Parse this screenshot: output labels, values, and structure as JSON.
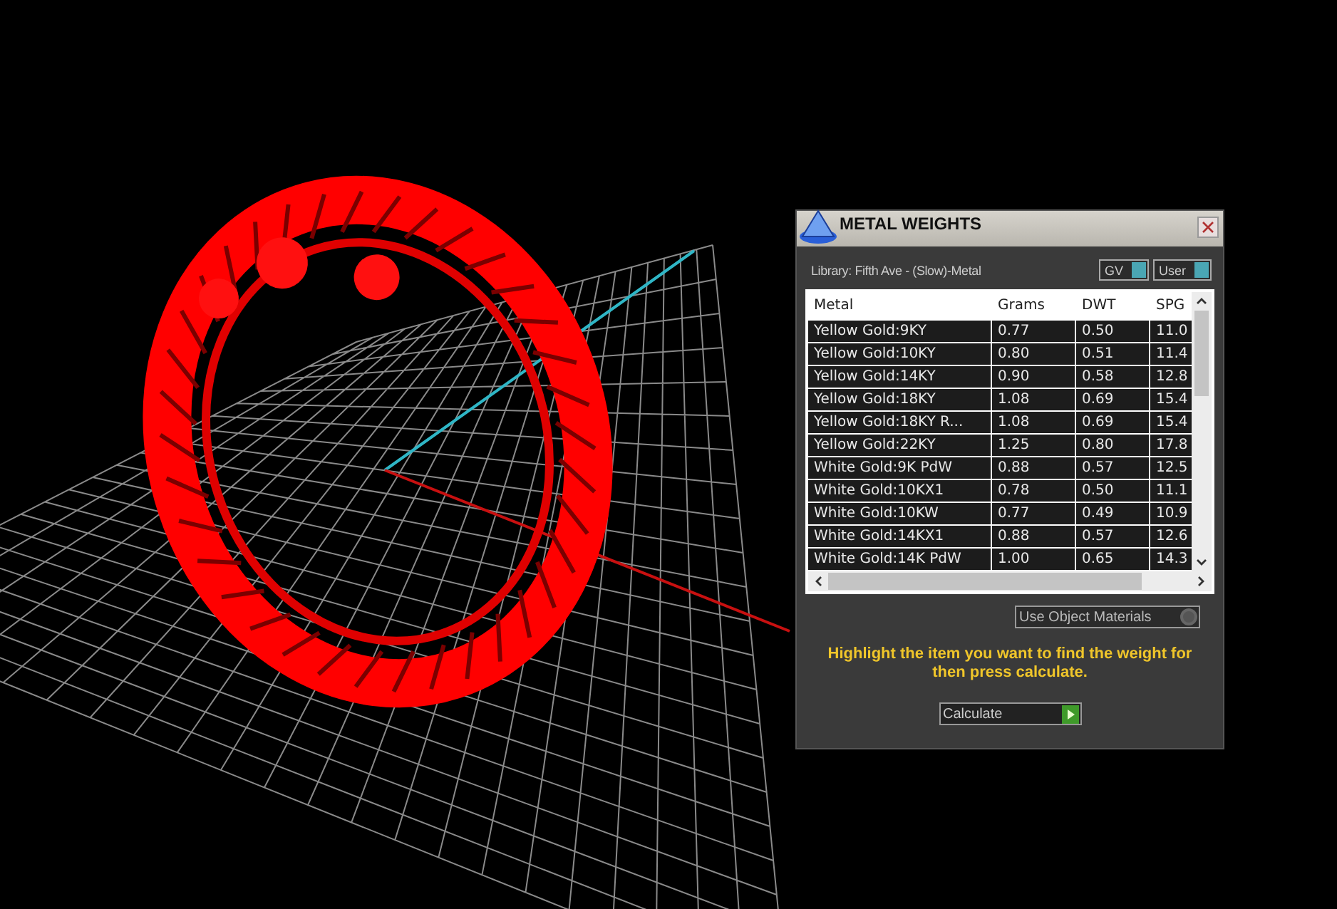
{
  "dialog": {
    "title": "METAL WEIGHTS",
    "library": "Library: Fifth Ave - (Slow)-Metal",
    "toggles": [
      {
        "label": "GV",
        "on": true
      },
      {
        "label": "User",
        "on": true
      }
    ],
    "table": {
      "columns": [
        "Metal",
        "Grams",
        "DWT",
        "SPG"
      ],
      "rows": [
        {
          "metal": "Yellow Gold:9KY",
          "grams": "0.77",
          "dwt": "0.50",
          "spg": "11.0"
        },
        {
          "metal": "Yellow Gold:10KY",
          "grams": "0.80",
          "dwt": "0.51",
          "spg": "11.4"
        },
        {
          "metal": "Yellow Gold:14KY",
          "grams": "0.90",
          "dwt": "0.58",
          "spg": "12.8"
        },
        {
          "metal": "Yellow Gold:18KY",
          "grams": "1.08",
          "dwt": "0.69",
          "spg": "15.4"
        },
        {
          "metal": "Yellow Gold:18KY R...",
          "grams": "1.08",
          "dwt": "0.69",
          "spg": "15.4"
        },
        {
          "metal": "Yellow Gold:22KY",
          "grams": "1.25",
          "dwt": "0.80",
          "spg": "17.8"
        },
        {
          "metal": "White Gold:9K PdW",
          "grams": "0.88",
          "dwt": "0.57",
          "spg": "12.5"
        },
        {
          "metal": "White Gold:10KX1",
          "grams": "0.78",
          "dwt": "0.50",
          "spg": "11.1"
        },
        {
          "metal": "White Gold:10KW",
          "grams": "0.77",
          "dwt": "0.49",
          "spg": "10.9"
        },
        {
          "metal": "White Gold:14KX1",
          "grams": "0.88",
          "dwt": "0.57",
          "spg": "12.6"
        },
        {
          "metal": "White Gold:14K PdW",
          "grams": "1.00",
          "dwt": "0.65",
          "spg": "14.3"
        }
      ]
    },
    "use_object_materials": {
      "label": "Use Object Materials",
      "on": false
    },
    "instruction": "Highlight the item you want to find the weight for then press calculate.",
    "calculate_button": "Calculate"
  }
}
